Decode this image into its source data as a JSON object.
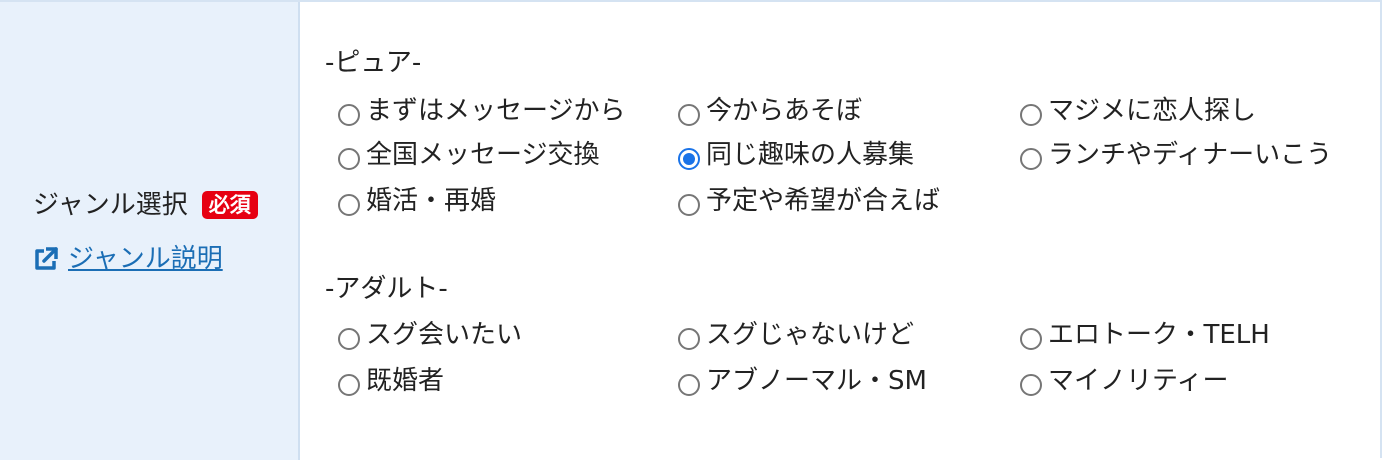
{
  "field": {
    "label": "ジャンル選択",
    "required_badge": "必須",
    "explain_link": "ジャンル説明",
    "link_icon": "external-link-icon"
  },
  "groups": [
    {
      "title": "-ピュア-",
      "options": [
        {
          "label": "まずはメッセージから",
          "checked": false
        },
        {
          "label": "今からあそぼ",
          "checked": false
        },
        {
          "label": "マジメに恋人探し",
          "checked": false
        },
        {
          "label": "全国メッセージ交換",
          "checked": false
        },
        {
          "label": "同じ趣味の人募集",
          "checked": true
        },
        {
          "label": "ランチやディナーいこう",
          "checked": false
        },
        {
          "label": "婚活・再婚",
          "checked": false
        },
        {
          "label": "予定や希望が合えば",
          "checked": false
        }
      ]
    },
    {
      "title": "-アダルト-",
      "options": [
        {
          "label": "スグ会いたい",
          "checked": false
        },
        {
          "label": "スグじゃないけど",
          "checked": false
        },
        {
          "label": "エロトーク・TELH",
          "checked": false
        },
        {
          "label": "既婚者",
          "checked": false
        },
        {
          "label": "アブノーマル・SM",
          "checked": false
        },
        {
          "label": "マイノリティー",
          "checked": false
        }
      ]
    }
  ],
  "colors": {
    "required": "#e60012",
    "link": "#1b6eb5",
    "label_bg": "#e8f1fb",
    "radio_checked": "#1a73e8"
  }
}
